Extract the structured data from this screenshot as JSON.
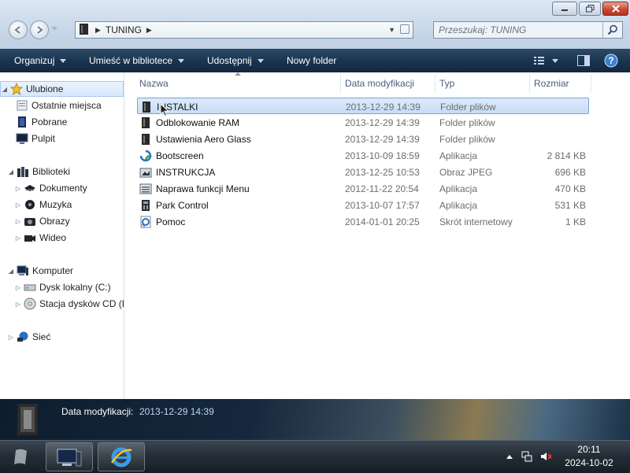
{
  "window": {
    "controls": {
      "minimize": "minimize",
      "maximize": "maximize",
      "close": "close"
    }
  },
  "address_bar": {
    "crumbs": [
      "TUNING"
    ],
    "search_placeholder": "Przeszukaj: TUNING"
  },
  "toolbar": {
    "organize": "Organizuj",
    "include_in_library": "Umieść w bibliotece",
    "share": "Udostępnij",
    "new_folder": "Nowy folder"
  },
  "nav_pane": {
    "favorites": {
      "label": "Ulubione",
      "items": [
        "Ostatnie miejsca",
        "Pobrane",
        "Pulpit"
      ]
    },
    "libraries": {
      "label": "Biblioteki",
      "items": [
        "Dokumenty",
        "Muzyka",
        "Obrazy",
        "Wideo"
      ]
    },
    "computer": {
      "label": "Komputer",
      "items": [
        "Dysk lokalny (C:)",
        "Stacja dysków CD (D"
      ]
    },
    "network": {
      "label": "Sieć"
    }
  },
  "file_list": {
    "columns": [
      "Nazwa",
      "Data modyfikacji",
      "Typ",
      "Rozmiar"
    ],
    "selected_index": 0,
    "rows": [
      {
        "name": "INSTALKI",
        "date": "2013-12-29 14:39",
        "type": "Folder plików",
        "size": "",
        "icon": "folder-icon"
      },
      {
        "name": "Odblokowanie RAM",
        "date": "2013-12-29 14:39",
        "type": "Folder plików",
        "size": "",
        "icon": "folder-icon"
      },
      {
        "name": "Ustawienia Aero Glass",
        "date": "2013-12-29 14:39",
        "type": "Folder plików",
        "size": "",
        "icon": "folder-icon"
      },
      {
        "name": "Bootscreen",
        "date": "2013-10-09 18:59",
        "type": "Aplikacja",
        "size": "2 814 KB",
        "icon": "app-bootscreen-icon"
      },
      {
        "name": "INSTRUKCJA",
        "date": "2013-12-25 10:53",
        "type": "Obraz JPEG",
        "size": "696 KB",
        "icon": "jpeg-image-icon"
      },
      {
        "name": "Naprawa funkcji Menu",
        "date": "2012-11-22 20:54",
        "type": "Aplikacja",
        "size": "470 KB",
        "icon": "app-window-icon"
      },
      {
        "name": "Park Control",
        "date": "2013-10-07 17:57",
        "type": "Aplikacja",
        "size": "531 KB",
        "icon": "app-park-control-icon"
      },
      {
        "name": "Pomoc",
        "date": "2014-01-01 20:25",
        "type": "Skrót internetowy",
        "size": "1 KB",
        "icon": "internet-shortcut-icon"
      }
    ]
  },
  "details_pane": {
    "label": "Data modyfikacji:",
    "value": "2013-12-29 14:39"
  },
  "taskbar": {
    "clock_time": "20:11",
    "clock_date": "2024-10-02"
  },
  "colors": {
    "toolbar": "#1a3550",
    "selection": "#c7ddf6",
    "taskbar": "#232c35"
  }
}
